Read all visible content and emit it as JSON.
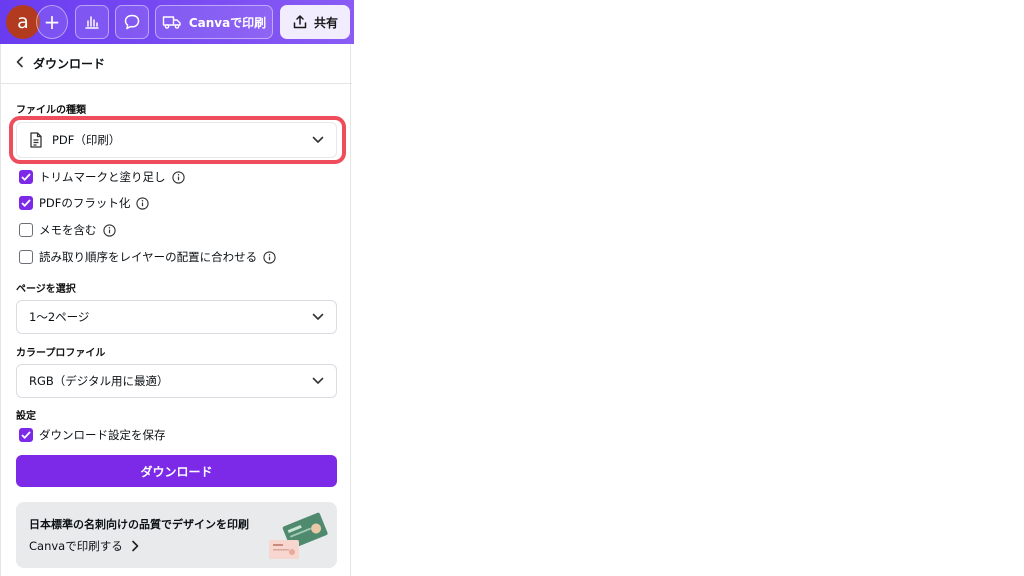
{
  "topbar": {
    "avatar_letter": "a",
    "plus_label": "+",
    "print_label": "Canvaで印刷",
    "share_label": "共有"
  },
  "panel": {
    "title": "ダウンロード",
    "filetype": {
      "label": "ファイルの種類",
      "value": "PDF（印刷）",
      "highlight_color": "#f04d5c"
    },
    "options": [
      {
        "label": "トリムマークと塗り足し",
        "checked": true,
        "info": true
      },
      {
        "label": "PDFのフラット化",
        "checked": true,
        "info": true
      },
      {
        "label": "メモを含む",
        "checked": false,
        "info": true
      },
      {
        "label": "読み取り順序をレイヤーの配置に合わせる",
        "checked": false,
        "info": true
      }
    ],
    "pages": {
      "label": "ページを選択",
      "value": "1〜2ページ"
    },
    "color_profile": {
      "label": "カラープロファイル",
      "value": "RGB（デジタル用に最適）"
    },
    "settings": {
      "label": "設定",
      "save_label": "ダウンロード設定を保存",
      "save_checked": true
    },
    "download_button": "ダウンロード",
    "promo": {
      "title": "日本標準の名刺向けの品質でデザインを印刷",
      "link": "Canvaで印刷する"
    }
  },
  "colors": {
    "accent": "#7d2ae8",
    "topbar": "#6a3cf0"
  }
}
